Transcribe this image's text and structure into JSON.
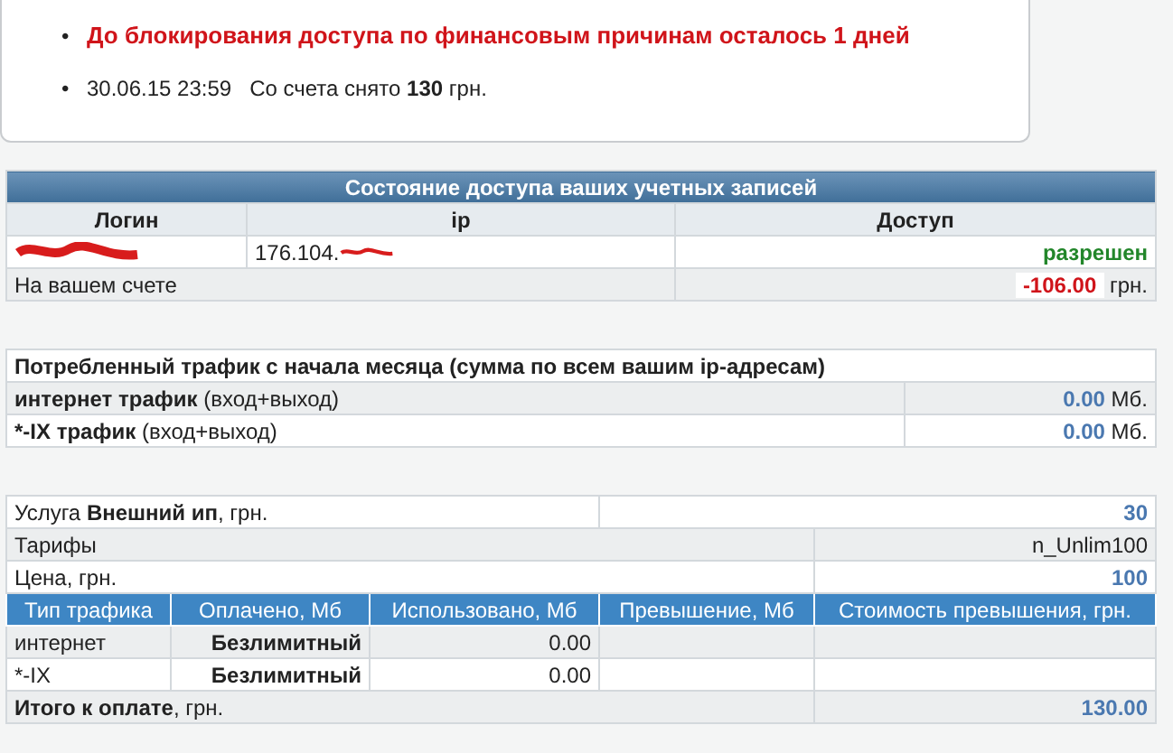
{
  "notices": [
    {
      "kind": "warning",
      "bullet": "•",
      "text": "До блокирования доступа по финансовым причинам осталось 1 дней"
    },
    {
      "kind": "charge",
      "bullet": "•",
      "date": "30.06.15 23:59",
      "text": "Со счета снято **130** грн."
    }
  ],
  "access_table": {
    "title": "Состояние доступа ваших учетных записей",
    "columns": [
      "Логин",
      "ip",
      "Доступ"
    ],
    "rows": [
      {
        "login_redacted": true,
        "ip": "176.104.",
        "ip_redacted": true,
        "access": "разрешен"
      }
    ],
    "balance": {
      "label": "На вашем счете",
      "amount": "-106.00",
      "unit": "грн."
    }
  },
  "traffic_table": {
    "title": "Потребленный трафик с начала месяца (сумма по всем вашим ip-адресам)",
    "rows": [
      {
        "label": "интернет трафик",
        "note": "(вход+выход)",
        "value": "0.00",
        "unit": "Мб."
      },
      {
        "label": "*-IX трафик",
        "note": "(вход+выход)",
        "value": "0.00",
        "unit": "Мб."
      }
    ]
  },
  "billing_table": {
    "service": {
      "label": "Услуга **Внешний ип**, грн.",
      "value": "30"
    },
    "tariff": {
      "label": "Тарифы",
      "value": "n_Unlim100"
    },
    "price": {
      "label": "Цена, грн.",
      "value": "100"
    },
    "columns": [
      "Тип трафика",
      "Оплачено, Мб",
      "Использовано, Мб",
      "Превышение, Мб",
      "Стоимость превышения, грн."
    ],
    "rows": [
      {
        "type": "интернет",
        "paid": "Безлимитный",
        "used": "0.00"
      },
      {
        "type": "*-IX",
        "paid": "Безлимитный",
        "used": "0.00"
      }
    ],
    "total": {
      "label": "**Итого к оплате**, грн.",
      "value": "130.00"
    }
  }
}
